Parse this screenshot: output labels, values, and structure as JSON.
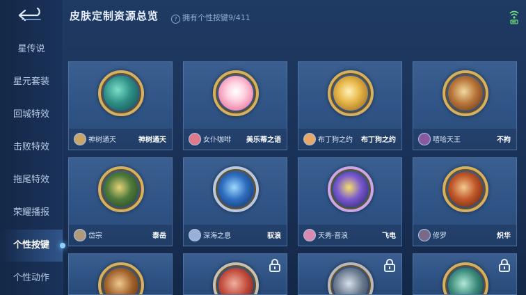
{
  "header": {
    "title": "皮肤定制资源总览",
    "count_label": "拥有个性按键9/411",
    "help_icon": "?"
  },
  "sidebar": {
    "items": [
      {
        "label": "星传说",
        "active": false
      },
      {
        "label": "星元套装",
        "active": false
      },
      {
        "label": "回城特效",
        "active": false
      },
      {
        "label": "击败特效",
        "active": false
      },
      {
        "label": "拖尾特效",
        "active": false
      },
      {
        "label": "荣耀播报",
        "active": false
      },
      {
        "label": "个性按键",
        "active": true
      },
      {
        "label": "个性动作",
        "active": false
      }
    ]
  },
  "cards": [
    {
      "skin": "神树通天",
      "hero": "神树通天",
      "emblem": "teal-feather",
      "locked": false
    },
    {
      "skin": "女仆咖啡",
      "hero": "美乐蒂之语",
      "emblem": "my-melody",
      "locked": false
    },
    {
      "skin": "布丁狗之约",
      "hero": "布丁狗之约",
      "emblem": "golden-bow",
      "locked": false
    },
    {
      "skin": "嘻哈天王",
      "hero": "不拘",
      "emblem": "bronze-shield",
      "locked": false
    },
    {
      "skin": "岱宗",
      "hero": "泰岳",
      "emblem": "green-gold-blade",
      "locked": false
    },
    {
      "skin": "深海之息",
      "hero": "驭浪",
      "emblem": "blue-whale",
      "locked": false
    },
    {
      "skin": "天秀·音浪",
      "hero": "飞电",
      "emblem": "purple-spear",
      "locked": false
    },
    {
      "skin": "修罗",
      "hero": "炽华",
      "emblem": "red-blade",
      "locked": false
    },
    {
      "skin": "",
      "hero": "",
      "emblem": "bronze-partial",
      "locked": false
    },
    {
      "skin": "",
      "hero": "",
      "emblem": "red-partial",
      "locked": true
    },
    {
      "skin": "",
      "hero": "",
      "emblem": "grey-partial",
      "locked": true
    },
    {
      "skin": "",
      "hero": "",
      "emblem": "teal-partial",
      "locked": true
    }
  ],
  "colors": {
    "accent": "#d4b060",
    "active_glow": "#8fd0ff",
    "wifi": "#6fe07a"
  }
}
